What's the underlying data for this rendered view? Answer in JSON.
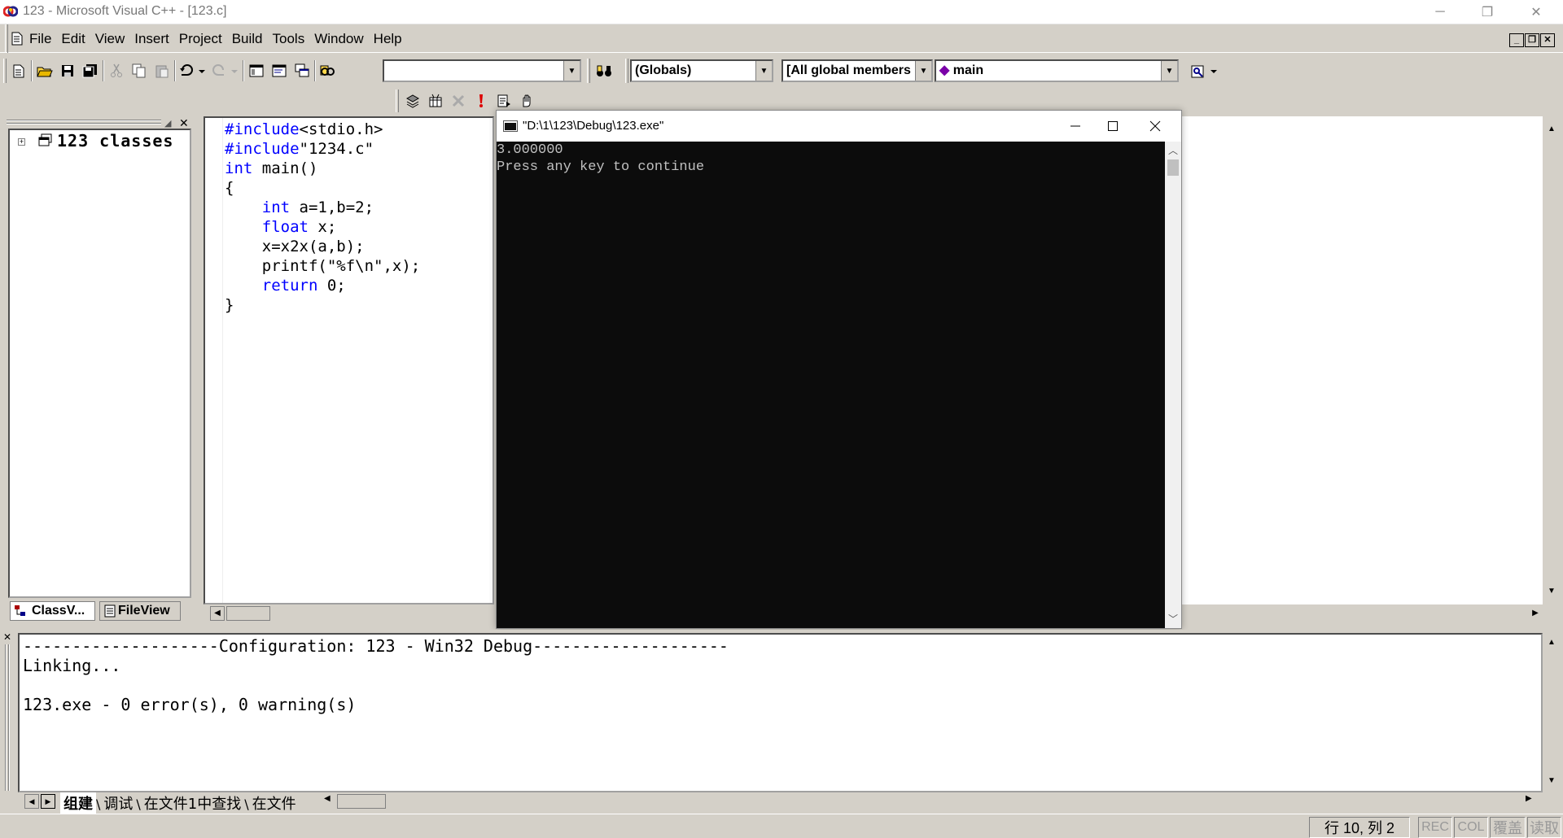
{
  "window": {
    "title": "123 - Microsoft Visual C++ - [123.c]",
    "minimize": "─",
    "restore": "❐",
    "close": "✕"
  },
  "menu": [
    {
      "label": "File"
    },
    {
      "label": "Edit"
    },
    {
      "label": "View"
    },
    {
      "label": "Insert"
    },
    {
      "label": "Project"
    },
    {
      "label": "Build"
    },
    {
      "label": "Tools"
    },
    {
      "label": "Window"
    },
    {
      "label": "Help"
    }
  ],
  "toolbar": {
    "find_combo_value": "",
    "scope_combo": "(Globals)",
    "members_combo": "[All global members",
    "function_combo": "main"
  },
  "workspace": {
    "tree_root": "123 classes",
    "tab_classview": "ClassV...",
    "tab_fileview": "FileView"
  },
  "editor": {
    "lines": [
      {
        "pre": "#include",
        "rest": "<stdio.h>"
      },
      {
        "pre": "#include",
        "rest": "\"1234.c\""
      },
      {
        "pre": "int",
        "rest": " main()"
      },
      {
        "pre": "",
        "rest": "{"
      },
      {
        "pre": "    int",
        "rest": " a=1,b=2;"
      },
      {
        "pre": "    float",
        "rest": " x;"
      },
      {
        "pre": "",
        "rest": "    x=x2x(a,b);"
      },
      {
        "pre": "",
        "rest": "    printf(\"%f\\n\",x);"
      },
      {
        "pre": "    return",
        "rest": " 0;"
      },
      {
        "pre": "",
        "rest": "}"
      }
    ]
  },
  "console": {
    "title": "\"D:\\1\\123\\Debug\\123.exe\"",
    "line1": "3.000000",
    "line2": "Press any key to continue"
  },
  "output": {
    "lines": [
      "--------------------Configuration: 123 - Win32 Debug--------------------",
      "Linking...",
      "",
      "123.exe - 0 error(s), 0 warning(s)"
    ],
    "tabs": [
      "组建",
      "调试",
      "在文件1中查找",
      "在文件"
    ]
  },
  "status": {
    "position": "行 10, 列 2",
    "rec": "REC",
    "col": "COL",
    "ovr": "覆盖",
    "read": "读取"
  },
  "colors": {
    "keyword": "#0000ff",
    "console_bg": "#0c0c0c",
    "chrome": "#d4d0c8"
  }
}
